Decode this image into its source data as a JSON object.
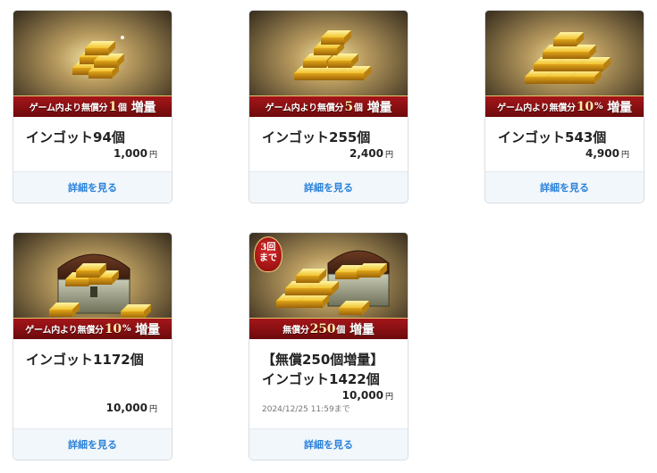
{
  "cards": [
    {
      "banner_pre": "ゲーム内より無償分",
      "banner_big": "1",
      "banner_unit": "個",
      "banner_end": "増量",
      "title": "インゴット94個",
      "price": "1,000",
      "yen": "円",
      "detail": "詳細を見る",
      "image": "gold-ingots-icon"
    },
    {
      "banner_pre": "ゲーム内より無償分",
      "banner_big": "5",
      "banner_unit": "個",
      "banner_end": "増量",
      "title": "インゴット255個",
      "price": "2,400",
      "yen": "円",
      "detail": "詳細を見る",
      "image": "gold-ingots-icon"
    },
    {
      "banner_pre": "ゲーム内より無償分",
      "banner_big": "10",
      "banner_unit": "%",
      "banner_end": "増量",
      "title": "インゴット543個",
      "price": "4,900",
      "yen": "円",
      "detail": "詳細を見る",
      "image": "gold-ingots-icon"
    },
    {
      "banner_pre": "ゲーム内より無償分",
      "banner_big": "10",
      "banner_unit": "%",
      "banner_end": "増量",
      "title": "インゴット1172個",
      "price": "10,000",
      "yen": "円",
      "detail": "詳細を見る",
      "image": "treasure-chest-icon"
    },
    {
      "seal": [
        "3回",
        "まで"
      ],
      "banner_pre": "無償分",
      "banner_big": "250",
      "banner_unit": "個",
      "banner_end": "増量",
      "title_line1": "【無償250個増量】",
      "title": "インゴット1422個",
      "price": "10,000",
      "yen": "円",
      "deadline": "2024/12/25 11:59まで",
      "detail": "詳細を見る",
      "image": "treasure-chest-icon"
    }
  ],
  "colors": {
    "link": "#2b82d9",
    "banner_red": "#a4161a",
    "gold": "#f2c230",
    "detail_bg": "#f2f7fc"
  }
}
